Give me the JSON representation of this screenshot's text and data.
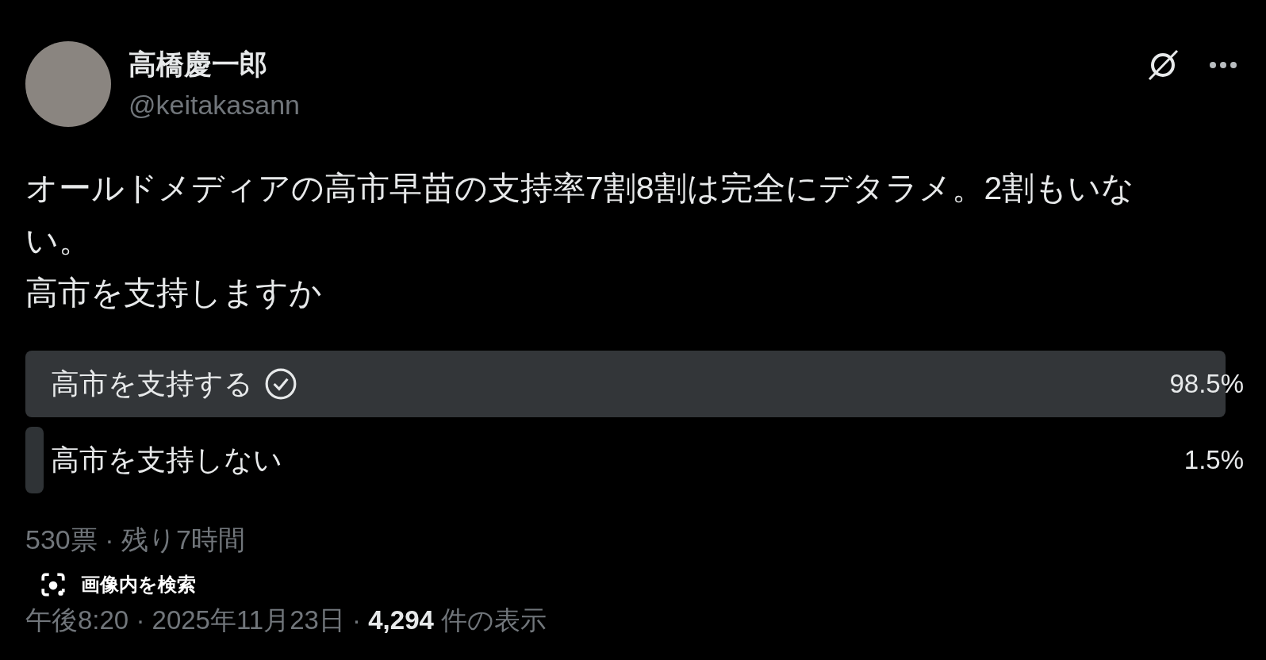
{
  "author": {
    "name": "高橋慶一郎",
    "handle": "@keitakasann"
  },
  "post": {
    "lines": [
      "オールドメディアの高市早苗の支持率7割8割は完全にデタラメ。2割もいない。",
      "高市を支持しますか"
    ]
  },
  "poll": {
    "options": [
      {
        "label": "高市を支持する",
        "percent": "98.5%",
        "level": 0.985,
        "selected": true
      },
      {
        "label": "高市を支持しない",
        "percent": "1.5%",
        "level": 0.015,
        "selected": false
      }
    ],
    "info": "530票 · 残り7時間"
  },
  "lens_button": {
    "label": "画像内を検索"
  },
  "meta": {
    "time": "午後8:20 · 2025年11月23日 · ",
    "views": "4,294",
    "views_suffix": " 件の表示"
  }
}
